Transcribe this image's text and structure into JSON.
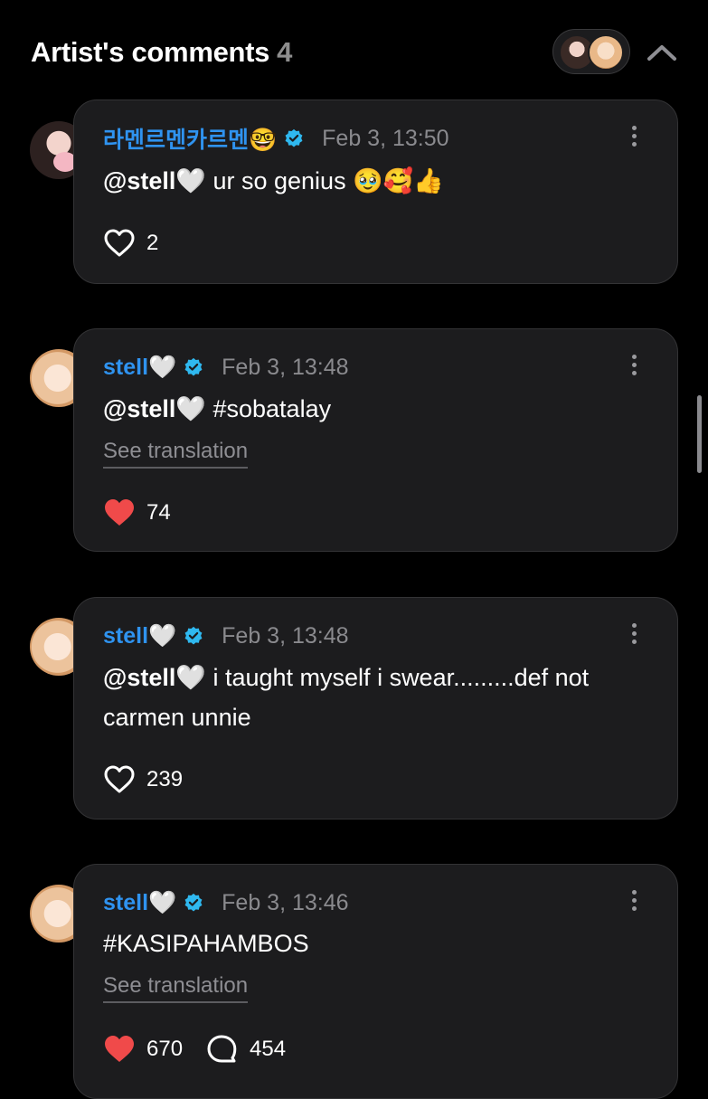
{
  "header": {
    "title": "Artist's comments",
    "count": "4"
  },
  "colors": {
    "background": "#000000",
    "card": "#1c1c1e",
    "author": "#2f93f0",
    "verified": "#2fb8ef",
    "like_active": "#f04a4a",
    "muted": "#8a8a8e"
  },
  "comments": [
    {
      "author": "라멘르멘카르멘🤓",
      "time": "Feb 3, 13:50",
      "mention": "@stell🤍",
      "text": " ur so genius 🥹🥰👍",
      "likes": "2",
      "liked": false
    },
    {
      "author": "stell🤍",
      "time": "Feb 3, 13:48",
      "mention": "@stell🤍",
      "text": " #sobatalay",
      "translation": "See translation",
      "likes": "74",
      "liked": true
    },
    {
      "author": "stell🤍",
      "time": "Feb 3, 13:48",
      "mention": "@stell🤍",
      "text": " i taught myself i swear.........def not carmen unnie",
      "likes": "239",
      "liked": false
    },
    {
      "author": "stell🤍",
      "time": "Feb 3, 13:46",
      "text": "#KASIPAHAMBOS",
      "translation": "See translation",
      "likes": "670",
      "liked": true,
      "replies": "454"
    }
  ]
}
